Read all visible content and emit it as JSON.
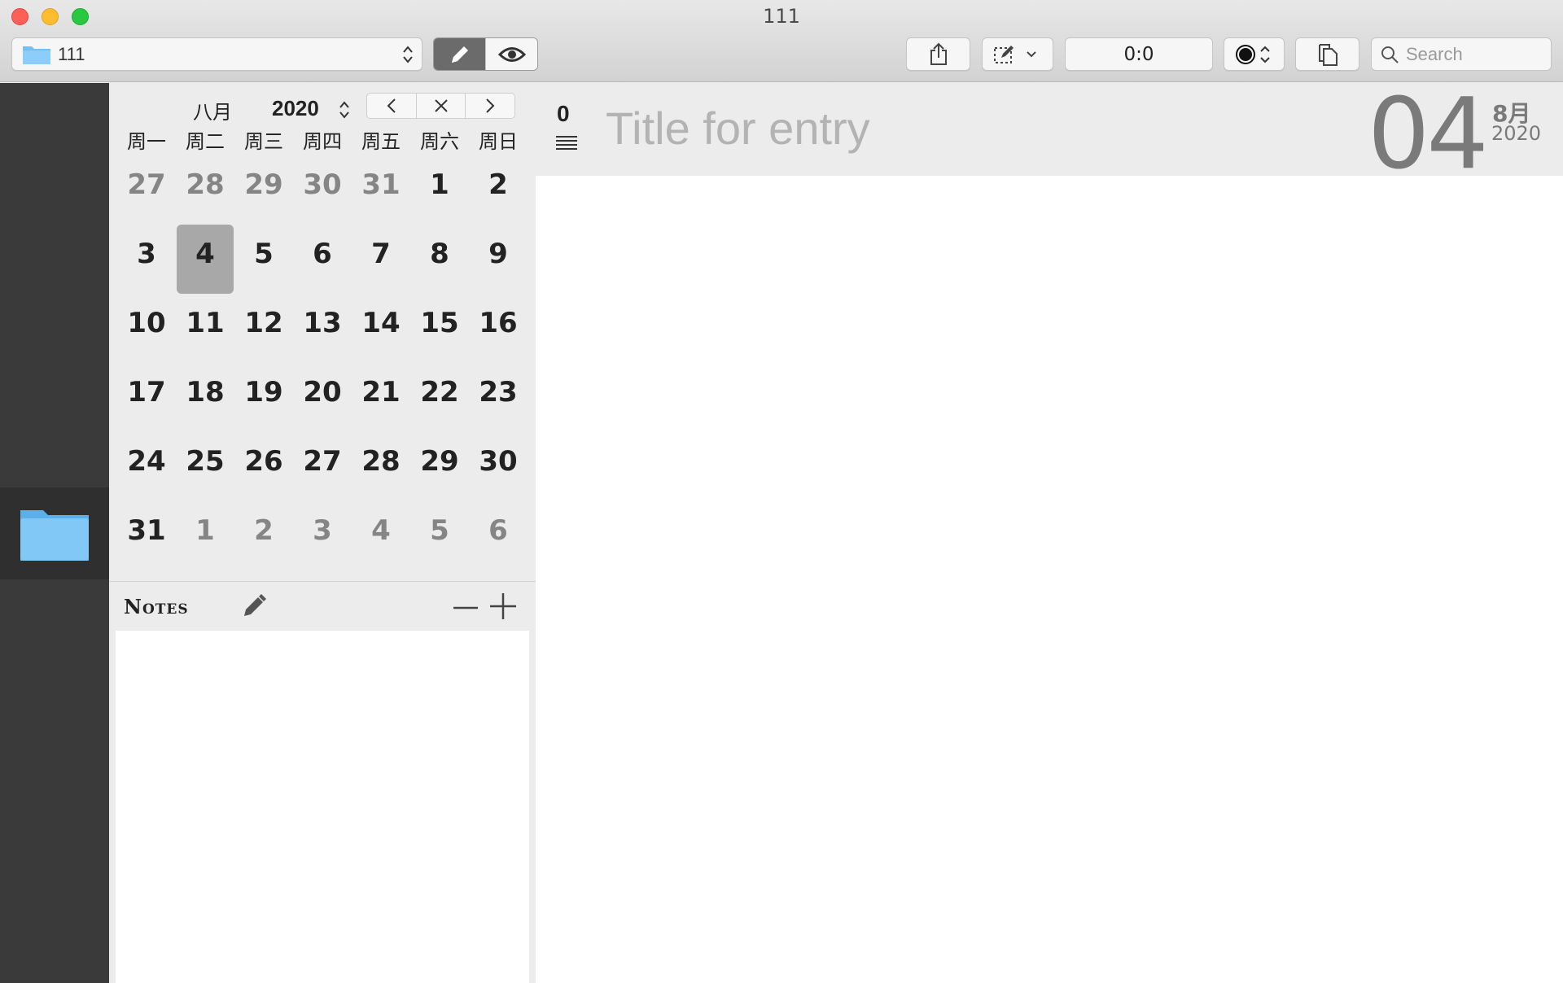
{
  "window": {
    "title": "111"
  },
  "toolbar": {
    "journal_name": "111",
    "counter": "0:0",
    "search_placeholder": "Search",
    "icons": [
      "folder-icon",
      "edit-mode-icon",
      "preview-eye-icon",
      "share-icon",
      "edit-dropdown-icon",
      "color-dot-icon",
      "copy-icon",
      "search-icon"
    ]
  },
  "calendar": {
    "month_label": "八月",
    "year": "2020",
    "weekdays": [
      "周一",
      "周二",
      "周三",
      "周四",
      "周五",
      "周六",
      "周日"
    ],
    "days": [
      {
        "n": "27",
        "dim": true
      },
      {
        "n": "28",
        "dim": true
      },
      {
        "n": "29",
        "dim": true
      },
      {
        "n": "30",
        "dim": true
      },
      {
        "n": "31",
        "dim": true
      },
      {
        "n": "1",
        "dim": false
      },
      {
        "n": "2",
        "dim": false
      },
      {
        "n": "3",
        "dim": false
      },
      {
        "n": "4",
        "dim": false,
        "selected": true
      },
      {
        "n": "5",
        "dim": false
      },
      {
        "n": "6",
        "dim": false
      },
      {
        "n": "7",
        "dim": false
      },
      {
        "n": "8",
        "dim": false
      },
      {
        "n": "9",
        "dim": false
      },
      {
        "n": "10",
        "dim": false
      },
      {
        "n": "11",
        "dim": false
      },
      {
        "n": "12",
        "dim": false
      },
      {
        "n": "13",
        "dim": false
      },
      {
        "n": "14",
        "dim": false
      },
      {
        "n": "15",
        "dim": false
      },
      {
        "n": "16",
        "dim": false
      },
      {
        "n": "17",
        "dim": false
      },
      {
        "n": "18",
        "dim": false
      },
      {
        "n": "19",
        "dim": false
      },
      {
        "n": "20",
        "dim": false
      },
      {
        "n": "21",
        "dim": false
      },
      {
        "n": "22",
        "dim": false
      },
      {
        "n": "23",
        "dim": false
      },
      {
        "n": "24",
        "dim": false
      },
      {
        "n": "25",
        "dim": false
      },
      {
        "n": "26",
        "dim": false
      },
      {
        "n": "27",
        "dim": false
      },
      {
        "n": "28",
        "dim": false
      },
      {
        "n": "29",
        "dim": false
      },
      {
        "n": "30",
        "dim": false
      },
      {
        "n": "31",
        "dim": false
      },
      {
        "n": "1",
        "dim": true
      },
      {
        "n": "2",
        "dim": true
      },
      {
        "n": "3",
        "dim": true
      },
      {
        "n": "4",
        "dim": true
      },
      {
        "n": "5",
        "dim": true
      },
      {
        "n": "6",
        "dim": true
      }
    ]
  },
  "notes": {
    "title": "Notes"
  },
  "entry": {
    "word_count": "0",
    "title_placeholder": "Title for entry",
    "day": "04",
    "month": "8月",
    "year": "2020"
  },
  "colors": {
    "sidebar_dark": "#3a3a3a",
    "selected_day": "#a8a8a8",
    "folder_blue": "#74c0f5",
    "close": "#fe5f57",
    "minimize": "#febc2e",
    "zoom": "#28c840"
  }
}
